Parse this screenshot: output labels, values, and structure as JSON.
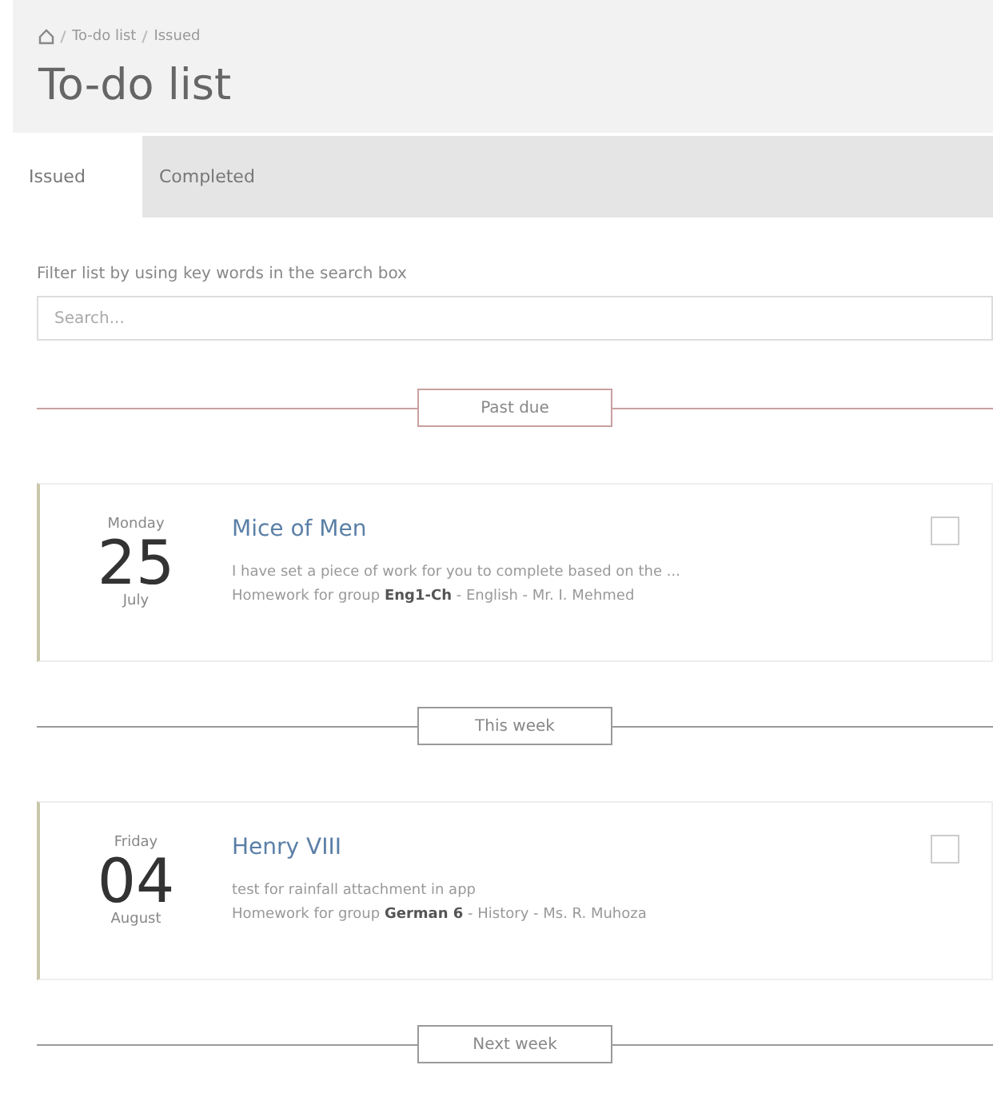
{
  "breadcrumb": [
    "To-do list",
    "Issued"
  ],
  "title": "To-do list",
  "tabs": [
    {
      "label": "Issued",
      "selected": true
    },
    {
      "label": "Completed",
      "selected": false
    }
  ],
  "filter": {
    "hint": "Filter list by using key words in the search box",
    "placeholder": "Search..."
  },
  "groups": [
    {
      "label": "Past due",
      "color": "#c9a0a0",
      "tasks": [
        {
          "weekday": "Monday",
          "day": "25",
          "month": "July",
          "title": "Mice of Men",
          "description": "I have set a piece of work for you to complete based on the ...",
          "meta": "Homework for group **Eng1-Ch** - English - Mr. I. Mehmed",
          "checked": false
        }
      ]
    },
    {
      "label": "This week",
      "color": "#9a9a9a",
      "tasks": [
        {
          "weekday": "Friday",
          "day": "04",
          "month": "August",
          "title": "Henry VIII",
          "description": "test for rainfall attachment in app",
          "meta": "Homework for group **German 6** - History - Ms. R. Muhoza",
          "checked": false
        }
      ]
    },
    {
      "label": "Next week",
      "color": "#9a9a9a"
    }
  ]
}
